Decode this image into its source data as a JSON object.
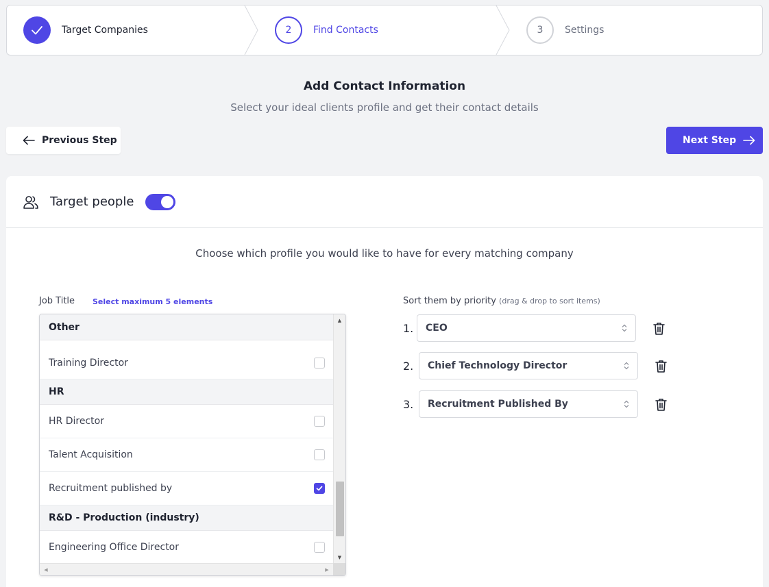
{
  "stepper": {
    "steps": [
      {
        "number": "1",
        "label": "Target Companies",
        "state": "completed",
        "icon": "check-icon"
      },
      {
        "number": "2",
        "label": "Find Contacts",
        "state": "active"
      },
      {
        "number": "3",
        "label": "Settings",
        "state": "pending"
      }
    ]
  },
  "header": {
    "title": "Add Contact Information",
    "subtitle": "Select your ideal clients profile and get their contact details"
  },
  "nav": {
    "previous_label": "Previous Step",
    "next_label": "Next Step"
  },
  "card": {
    "title": "Target people",
    "toggle_on": true,
    "description": "Choose which profile you would like to have for every matching company"
  },
  "job_title": {
    "label": "Job Title",
    "hint": "Select maximum 5 elements",
    "groups": [
      {
        "name": "Other",
        "items": [
          {
            "label": "Training Director",
            "checked": false
          }
        ]
      },
      {
        "name": "HR",
        "items": [
          {
            "label": "HR Director",
            "checked": false
          },
          {
            "label": "Talent Acquisition",
            "checked": false
          },
          {
            "label": "Recruitment published by",
            "checked": true
          }
        ]
      },
      {
        "name": "R&D - Production (industry)",
        "items": [
          {
            "label": "Engineering Office Director",
            "checked": false
          }
        ]
      }
    ]
  },
  "priority": {
    "label": "Sort them by priority",
    "sub_label": "(drag & drop to sort items)",
    "items": [
      {
        "number": "1.",
        "value": "CEO"
      },
      {
        "number": "2.",
        "value": "Chief Technology Director"
      },
      {
        "number": "3.",
        "value": "Recruitment Published By"
      }
    ]
  },
  "colors": {
    "accent": "#4f46e5",
    "background": "#f2f3f5",
    "text": "#1f2330"
  }
}
